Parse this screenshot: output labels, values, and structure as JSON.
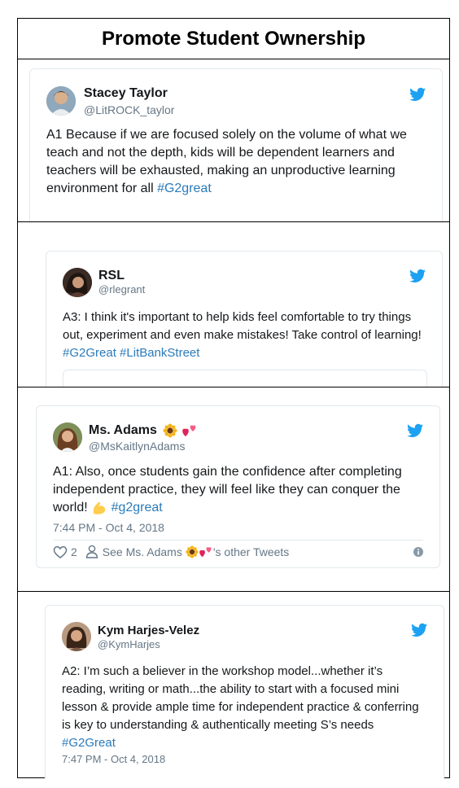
{
  "page": {
    "title": "Promote Student Ownership"
  },
  "tweets": [
    {
      "name": "Stacey Taylor",
      "handle": "@LitROCK_taylor",
      "text": "A1 Because if we are focused solely on the volume of what we teach and not the depth, kids will be dependent learners and teachers will be exhausted, making an unproductive learning environment for all ",
      "hashtags": [
        "#G2great"
      ]
    },
    {
      "name": "RSL",
      "handle": "@rlegrant",
      "text": "A3: I think it's important to help kids  feel comfortable to try things out, experiment and even make mistakes! Take control of learning! ",
      "hashtags": [
        "#G2Great",
        "#LitBankStreet"
      ]
    },
    {
      "name": "Ms. Adams",
      "name_emoji": [
        "sunflower-icon",
        "two-hearts-icon"
      ],
      "handle": "@MsKaitlynAdams",
      "text_before": "A1: Also, once students gain the confidence after completing independent practice, they will feel like they can conquer the world! ",
      "text_emoji": "flexed-biceps-icon",
      "hashtags": [
        "#g2great"
      ],
      "timestamp": "7:44 PM - Oct 4, 2018",
      "like_count": "2",
      "see_other_prefix": "See Ms. Adams",
      "see_other_suffix": "'s other Tweets"
    },
    {
      "name": "Kym Harjes-Velez",
      "handle": "@KymHarjes",
      "text": "A2: I’m such a believer in the workshop model...whether it’s reading, writing or math...the ability to start with a focused mini lesson & provide ample time for independent practice & conferring is key to understanding & authentically meeting S’s needs ",
      "hashtags": [
        "#G2Great"
      ],
      "timestamp": "7:47 PM - Oct 4, 2018"
    }
  ],
  "colors": {
    "link": "#2b7bb9",
    "twitter_blue": "#1da1f2",
    "muted": "#657786",
    "border": "#e1e8ed"
  }
}
